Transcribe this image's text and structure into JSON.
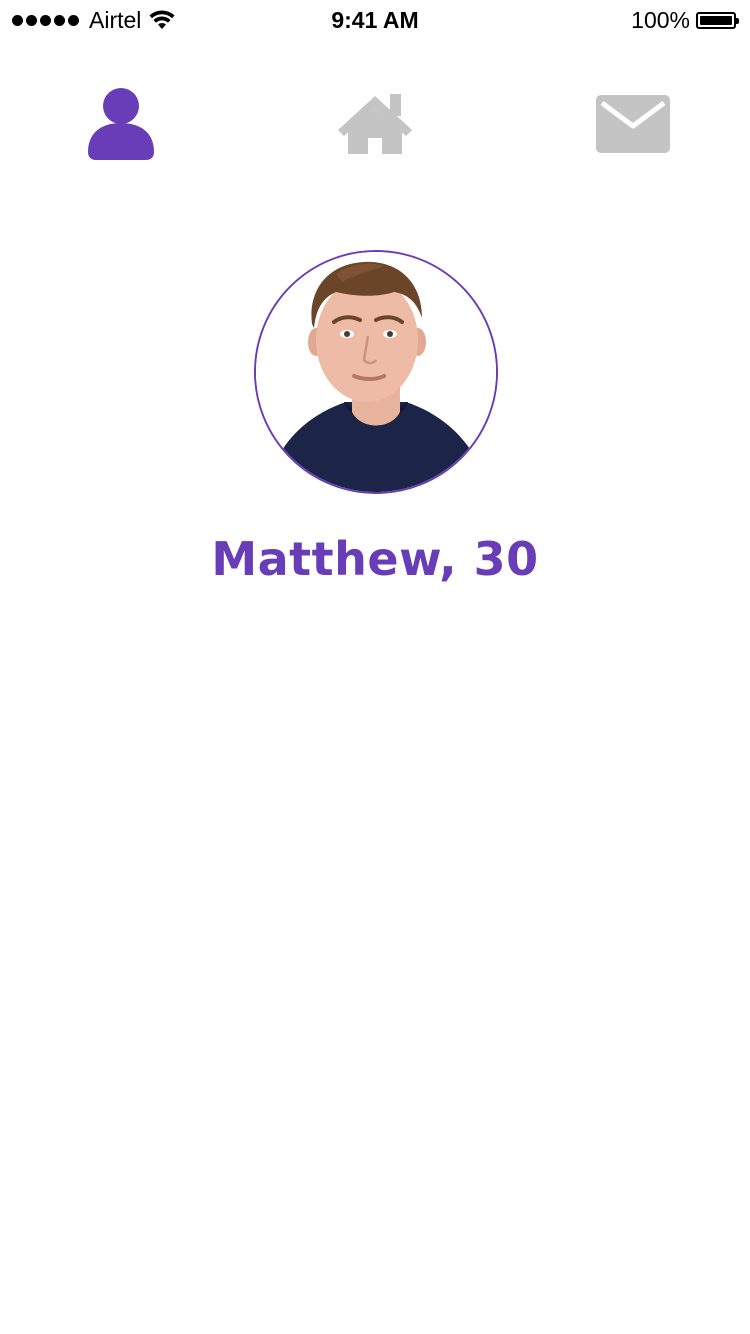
{
  "status_bar": {
    "carrier": "Airtel",
    "time": "9:41 AM",
    "battery": "100%",
    "signal_icon": "signal-dots-icon",
    "wifi_icon": "wifi-icon",
    "battery_icon": "battery-icon"
  },
  "nav": {
    "tabs": [
      {
        "name": "profile",
        "icon": "user-icon",
        "active": true
      },
      {
        "name": "home",
        "icon": "home-icon",
        "active": false
      },
      {
        "name": "messages",
        "icon": "mail-icon",
        "active": false
      }
    ],
    "active_color": "#6a3db8",
    "inactive_color": "#c4c4c4"
  },
  "profile": {
    "name_age": "Matthew, 30",
    "avatar": "profile-photo"
  },
  "colors": {
    "accent": "#6a3db8",
    "background": "#ffffff"
  }
}
